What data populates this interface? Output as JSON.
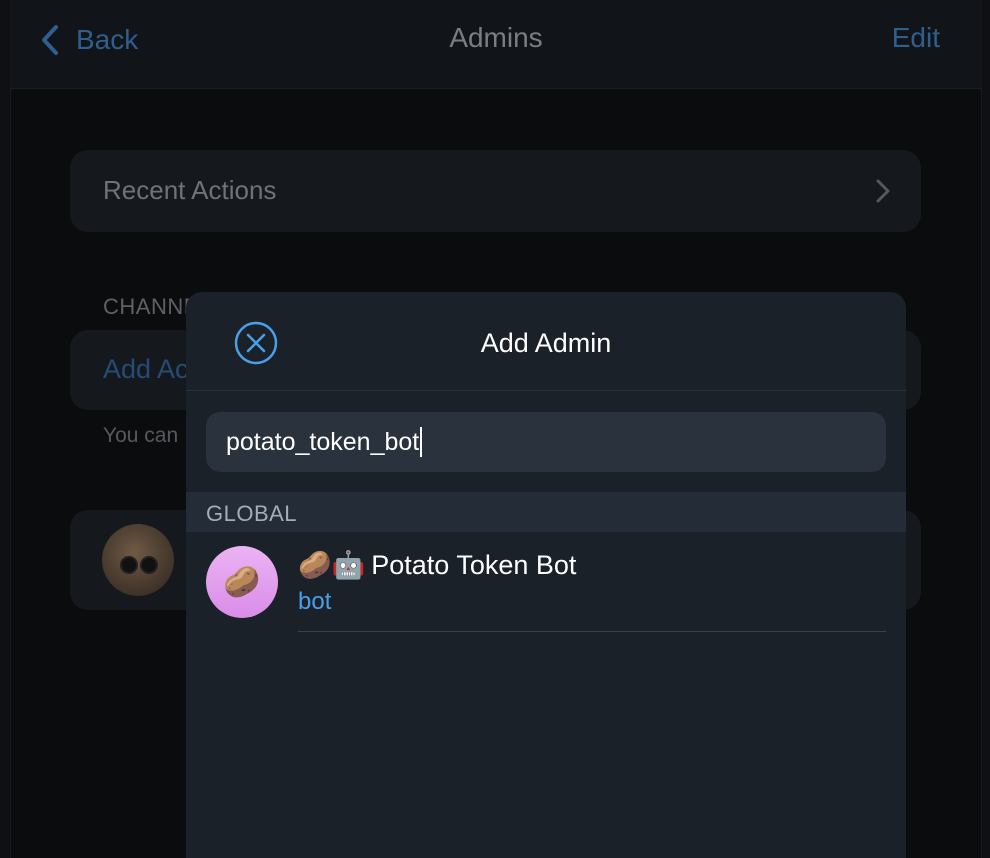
{
  "navbar": {
    "back_label": "Back",
    "title": "Admins",
    "edit_label": "Edit"
  },
  "background": {
    "recent_actions": "Recent Actions",
    "section_title": "CHANNE",
    "add_admin_partial": "Add Ac",
    "footnote_partial": "You can"
  },
  "modal": {
    "title": "Add Admin",
    "search_value": "potato_token_bot",
    "section_label": "GLOBAL",
    "results": [
      {
        "emoji_prefix": "🥔🤖",
        "name": "Potato Token Bot",
        "subtitle": "bot",
        "avatar_emoji": "🥔"
      }
    ]
  },
  "colors": {
    "accent": "#4a9fe8",
    "modal_bg": "#1b2129",
    "search_bg": "#2a323d",
    "avatar_bg": "#e0a0ee"
  },
  "icons": {
    "back": "chevron-left-icon",
    "recent_chevron": "chevron-right-icon",
    "close": "close-circle-icon"
  }
}
